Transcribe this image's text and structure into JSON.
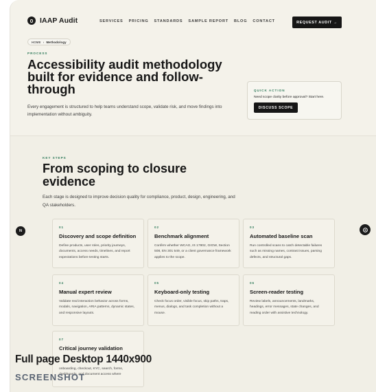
{
  "nav": {
    "brand": "IAAP Audit",
    "links": [
      "SERVICES",
      "PRICING",
      "STANDARDS",
      "SAMPLE REPORT",
      "BLOG",
      "CONTACT"
    ],
    "cta": "REQUEST AUDIT →"
  },
  "breadcrumb": {
    "home": "HOME",
    "sep": "›",
    "current": "Methodology"
  },
  "hero": {
    "eyebrow": "PROCESS",
    "title": "Accessibility audit methodology built for evidence and follow-through",
    "lead": "Every engagement is structured to help teams understand scope, validate risk, and move findings into implementation without ambiguity."
  },
  "quick_action": {
    "label": "QUICK ACTION",
    "text": "Need scope clarity before approval? Start here.",
    "button": "DISCUSS SCOPE"
  },
  "steps": {
    "eyebrow": "KEY STEPS",
    "title": "From scoping to closure evidence",
    "lead": "Each stage is designed to improve decision quality for compliance, product, design, engineering, and QA stakeholders.",
    "cards": [
      {
        "num": "01",
        "title": "Discovery and scope definition",
        "desc": "Define products, user roles, priority journeys, documents, access needs, timelines, and report expectations before testing starts."
      },
      {
        "num": "02",
        "title": "Benchmark alignment",
        "desc": "Confirm whether WCAG, IS 17802, GIGW, Section 508, EN 301 549, or a client governance framework applies to the scope."
      },
      {
        "num": "03",
        "title": "Automated baseline scan",
        "desc": "Run controlled scans to catch detectable failures such as missing names, contrast issues, parsing defects, and structural gaps."
      },
      {
        "num": "04",
        "title": "Manual expert review",
        "desc": "Validate real interaction behavior across forms, modals, navigation, ARIA patterns, dynamic states, and responsive layouts."
      },
      {
        "num": "05",
        "title": "Keyboard-only testing",
        "desc": "Check focus order, visible focus, skip paths, traps, menus, dialogs, and task completion without a mouse."
      },
      {
        "num": "06",
        "title": "Screen-reader testing",
        "desc": "Review labels, announcements, landmarks, headings, error messages, state changes, and reading order with assistive technology."
      },
      {
        "num": "07",
        "title": "Critical journey validation",
        "desc": "onboarding, checkout, KYC, search, forms, dashboards, and document access where"
      }
    ]
  },
  "side": {
    "left": "N",
    "right_icon": "gear-icon"
  },
  "overlay": {
    "label": "Full page Desktop 1440x900",
    "tag": "SCREENSHOT"
  }
}
